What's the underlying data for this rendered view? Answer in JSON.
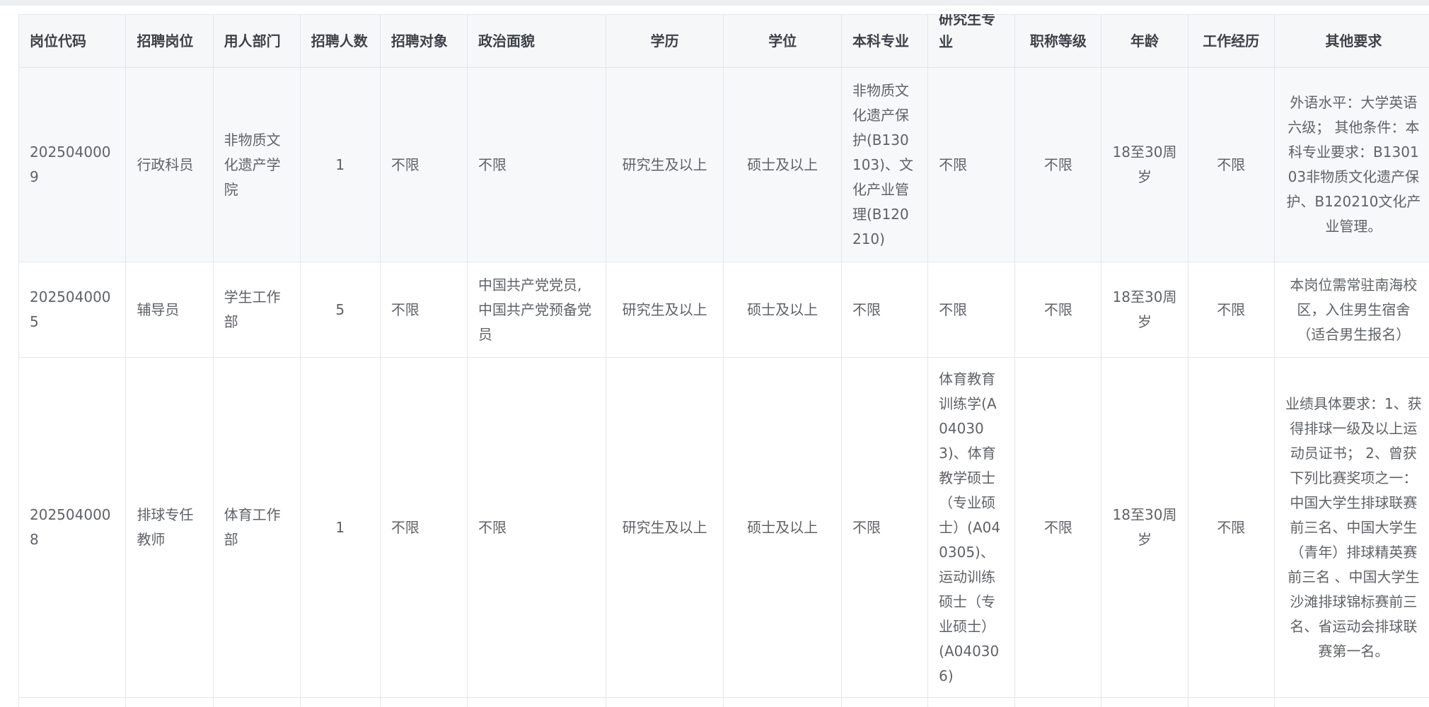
{
  "columns": [
    "岗位代码",
    "招聘岗位",
    "用人部门",
    "招聘人数",
    "招聘对象",
    "政治面貌",
    "学历",
    "学位",
    "本科专业",
    "研究生专业",
    "职称等级",
    "年龄",
    "工作经历",
    "其他要求"
  ],
  "rows": [
    {
      "code": "2025040009",
      "position": "行政科员",
      "department": "非物质文化遗产学院",
      "count": "1",
      "target": "不限",
      "political": "不限",
      "education": "研究生及以上",
      "degree": "硕士及以上",
      "undergrad_major": "非物质文化遗产保护(B130103)、文化产业管理(B120210)",
      "grad_major": "不限",
      "title_level": "不限",
      "age": "18至30周岁",
      "experience": "不限",
      "other": "外语水平：大学英语六级； 其他条件：本科专业要求：B130103非物质文化遗产保护、B120210文化产业管理。"
    },
    {
      "code": "2025040005",
      "position": "辅导员",
      "department": "学生工作部",
      "count": "5",
      "target": "不限",
      "political": "中国共产党党员,中国共产党预备党员",
      "education": "研究生及以上",
      "degree": "硕士及以上",
      "undergrad_major": "不限",
      "grad_major": "不限",
      "title_level": "不限",
      "age": "18至30周岁",
      "experience": "不限",
      "other": "本岗位需常驻南海校区，入住男生宿舍（适合男生报名）"
    },
    {
      "code": "2025040008",
      "position": "排球专任教师",
      "department": "体育工作部",
      "count": "1",
      "target": "不限",
      "political": "不限",
      "education": "研究生及以上",
      "degree": "硕士及以上",
      "undergrad_major": "不限",
      "grad_major": "体育教育训练学(A040303)、体育教学硕士（专业硕士）(A040305)、运动训练硕士（专业硕士）(A040306)",
      "title_level": "不限",
      "age": "18至30周岁",
      "experience": "不限",
      "other": "业绩具体要求：1、获得排球一级及以上运动员证书； 2、曾获下列比赛奖项之一：中国大学生排球联赛前三名、中国大学生（青年）排球精英赛前三名 、中国大学生沙滩排球锦标赛前三名、省运动会排球联赛第一名。"
    }
  ]
}
